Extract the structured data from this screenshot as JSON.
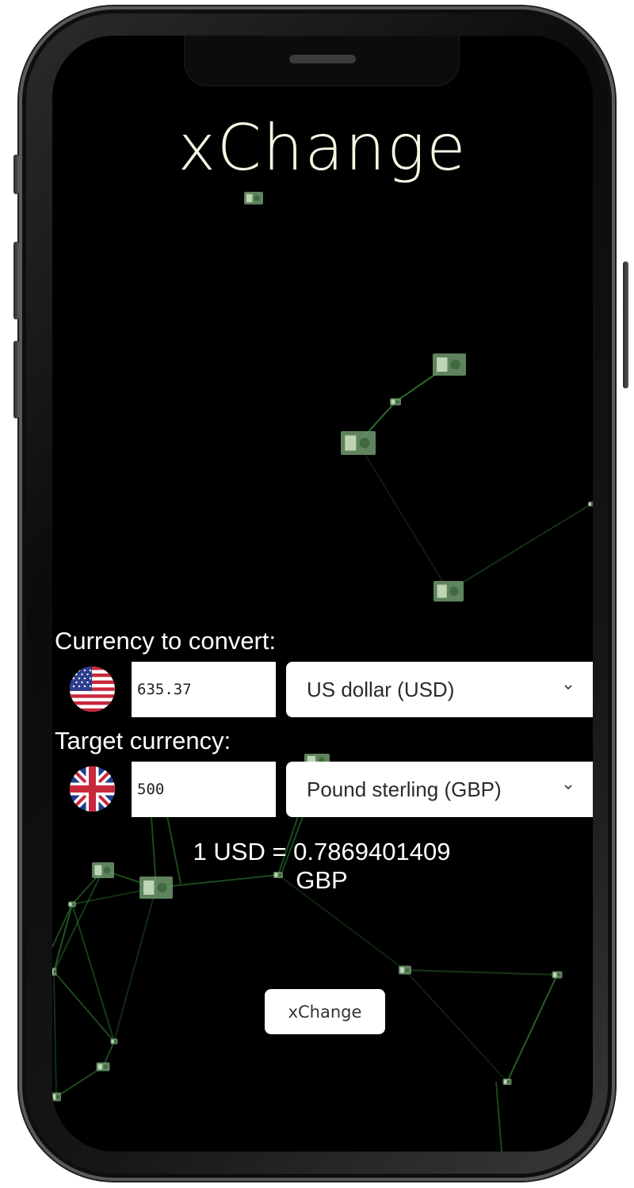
{
  "app": {
    "title": "xChange"
  },
  "converter": {
    "from_label": "Currency to convert:",
    "from_amount": "635.37",
    "from_currency": "US dollar (USD)",
    "from_flag": "us-flag-icon",
    "to_label": "Target currency:",
    "to_amount": "500",
    "to_currency": "Pound sterling (GBP)",
    "to_flag": "uk-flag-icon",
    "rate_line1": "1 USD = 0.7869401409",
    "rate_line2": "GBP",
    "button_label": "xChange"
  },
  "colors": {
    "background": "#000000",
    "title": "#f8f5e3",
    "network_line": "#2e7a2e",
    "money_bill": "#6f9a6f"
  },
  "icons": {
    "money": "money-bill-icon",
    "chevron": "chevron-down-icon"
  }
}
